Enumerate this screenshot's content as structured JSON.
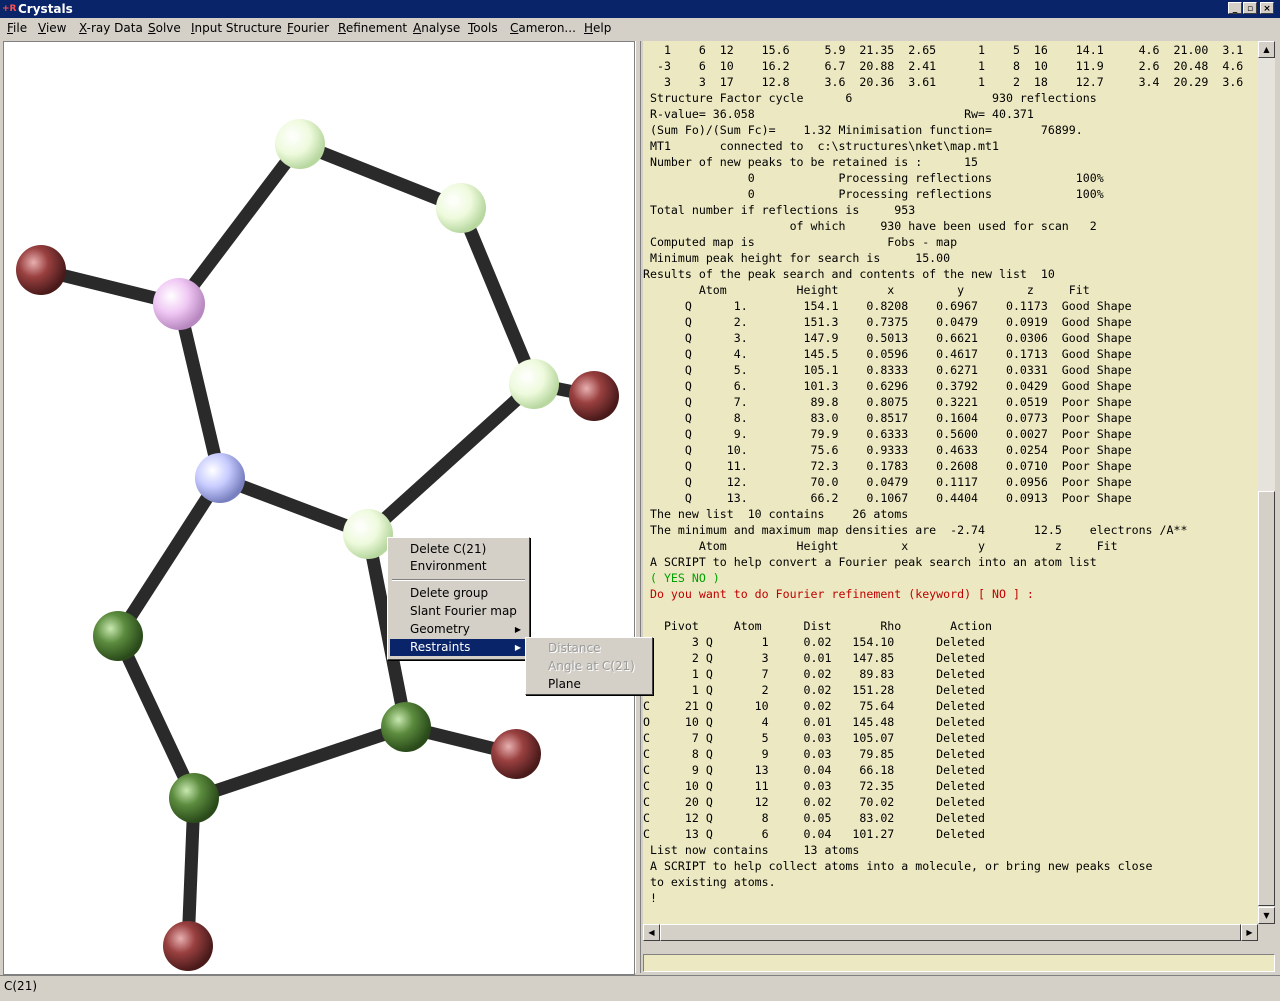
{
  "window": {
    "title": "Crystals",
    "icon_text": "+R",
    "min": "_",
    "max": "▫",
    "close": "×"
  },
  "menu": [
    "File",
    "View",
    "X-ray Data",
    "Solve",
    "Input Structure",
    "Fourier",
    "Refinement",
    "Analyse",
    "Tools",
    "Cameron...",
    "Help"
  ],
  "output_lines": [
    "   1    6  12    15.6     5.9  21.35  2.65      1    5  16    14.1     4.6  21.00  3.1",
    "  -3    6  10    16.2     6.7  20.88  2.41      1    8  10    11.9     2.6  20.48  4.6",
    "   3    3  17    12.8     3.6  20.36  3.61      1    2  18    12.7     3.4  20.29  3.6",
    " Structure Factor cycle      6                    930 reflections",
    " R-value= 36.058                              Rw= 40.371",
    " (Sum Fo)/(Sum Fc)=    1.32 Minimisation function=       76899.",
    " MT1       connected to  c:\\structures\\nket\\map.mt1",
    " Number of new peaks to be retained is :      15",
    "               0            Processing reflections            100%",
    "               0            Processing reflections            100%",
    " Total number if reflections is     953",
    "                     of which     930 have been used for scan   2",
    " Computed map is                   Fobs - map",
    " Minimum peak height for search is     15.00",
    "Results of the peak search and contents of the new list  10",
    "        Atom          Height       x         y         z     Fit",
    "      Q      1.        154.1    0.8208    0.6967    0.1173  Good Shape",
    "      Q      2.        151.3    0.7375    0.0479    0.0919  Good Shape",
    "      Q      3.        147.9    0.5013    0.6621    0.0306  Good Shape",
    "      Q      4.        145.5    0.0596    0.4617    0.1713  Good Shape",
    "      Q      5.        105.1    0.8333    0.6271    0.0331  Good Shape",
    "      Q      6.        101.3    0.6296    0.3792    0.0429  Good Shape",
    "      Q      7.         89.8    0.8075    0.3221    0.0519  Poor Shape",
    "      Q      8.         83.0    0.8517    0.1604    0.0773  Poor Shape",
    "      Q      9.         79.9    0.6333    0.5600    0.0027  Poor Shape",
    "      Q     10.         75.6    0.9333    0.4633    0.0254  Poor Shape",
    "      Q     11.         72.3    0.1783    0.2608    0.0710  Poor Shape",
    "      Q     12.         70.0    0.0479    0.1117    0.0956  Poor Shape",
    "      Q     13.         66.2    0.1067    0.4404    0.0913  Poor Shape",
    " The new list  10 contains    26 atoms",
    " The minimum and maximum map densities are  -2.74       12.5    electrons /A**",
    "        Atom          Height         x          y          z     Fit",
    " A SCRIPT to help convert a Fourier peak search into an atom list",
    " ( YES NO )",
    " Do you want to do Fourier refinement (keyword) [ NO ] :",
    "",
    "   Pivot     Atom      Dist       Rho       Action",
    "O      3 Q       1     0.02   154.10      Deleted",
    "O      2 Q       3     0.01   147.85      Deleted",
    "N      1 Q       7     0.02    89.83      Deleted",
    "O      1 Q       2     0.02   151.28      Deleted",
    "C     21 Q      10     0.02    75.64      Deleted",
    "O     10 Q       4     0.01   145.48      Deleted",
    "C      7 Q       5     0.03   105.07      Deleted",
    "C      8 Q       9     0.03    79.85      Deleted",
    "C      9 Q      13     0.04    66.18      Deleted",
    "C     10 Q      11     0.03    72.35      Deleted",
    "C     20 Q      12     0.02    70.02      Deleted",
    "C     12 Q       8     0.05    83.02      Deleted",
    "C     13 Q       6     0.04   101.27      Deleted",
    " List now contains     13 atoms",
    " A SCRIPT to help collect atoms into a molecule, or bring new peaks close",
    " to existing atoms.",
    " !"
  ],
  "line_colors": {
    "33": "green",
    "34": "red"
  },
  "context_menu": {
    "delete_atom": "Delete C(21)",
    "environment": "Environment",
    "delete_group": "Delete group",
    "slant_fourier": "Slant Fourier map",
    "geometry": "Geometry",
    "restraints": "Restraints"
  },
  "submenu": {
    "distance": "Distance",
    "angle": "Angle at C(21)",
    "plane": "Plane"
  },
  "status": "C(21)",
  "colors": {
    "oxygen": "#8c3a3a",
    "nitrogen": "#c8ccff",
    "carbon": "#5a8a3c",
    "unknown_white": "#f4ffe4",
    "pink": "#f0c8f4",
    "text_bg": "#ece9c2"
  }
}
